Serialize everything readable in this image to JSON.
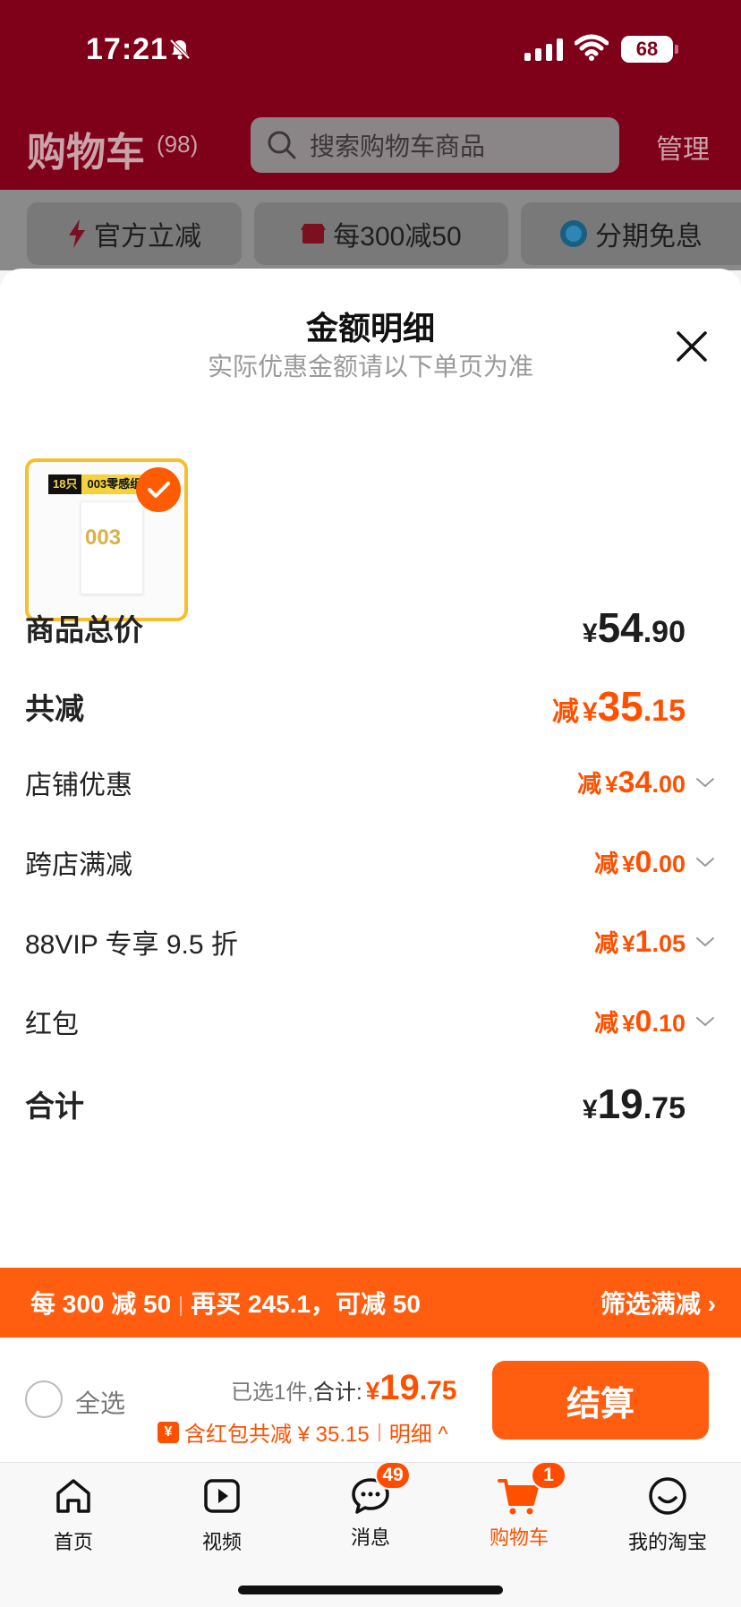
{
  "status": {
    "time": "17:21",
    "battery": "68"
  },
  "header": {
    "title": "购物车",
    "count": "(98)",
    "search_placeholder": "搜索购物车商品",
    "manage": "管理"
  },
  "promos": [
    "官方立减",
    "每300减50",
    "分期免息"
  ],
  "sheet": {
    "title": "金额明细",
    "subtitle": "实际优惠金额请以下单页为准",
    "product": {
      "tag_count": "18只",
      "tag_name": "003零感组",
      "box_text": "003"
    },
    "rows": [
      {
        "label": "商品总价",
        "prefix": "",
        "symbol": "¥",
        "int": "54",
        "dec": ".90"
      },
      {
        "label": "共减",
        "prefix": "减",
        "symbol": "¥",
        "int": "35",
        "dec": ".15"
      },
      {
        "label": "店铺优惠",
        "prefix": "减",
        "symbol": "¥",
        "int": "34",
        "dec": ".00"
      },
      {
        "label": "跨店满减",
        "prefix": "减",
        "symbol": "¥",
        "int": "0",
        "dec": ".00"
      },
      {
        "label": "88VIP 专享 9.5 折",
        "prefix": "减",
        "symbol": "¥",
        "int": "1",
        "dec": ".05"
      },
      {
        "label": "红包",
        "prefix": "减",
        "symbol": "¥",
        "int": "0",
        "dec": ".10"
      },
      {
        "label": "合计",
        "prefix": "",
        "symbol": "¥",
        "int": "19",
        "dec": ".75"
      }
    ]
  },
  "promo_bar": {
    "left_a": "每 300 减 50",
    "left_b": "再买 245.1，可减 50",
    "right": "筛选满减 ›"
  },
  "checkout": {
    "select_all": "全选",
    "selected": "已选1件,",
    "sum_label": "合计:",
    "price_symbol": "¥",
    "price_int": "19",
    "price_dec": ".75",
    "badge": "¥",
    "discount_text": "含红包共减 ¥ 35.15",
    "detail": "明细 ^",
    "settle": "结算"
  },
  "tabs": [
    {
      "label": "首页",
      "badge": ""
    },
    {
      "label": "视频",
      "badge": ""
    },
    {
      "label": "消息",
      "badge": "49"
    },
    {
      "label": "购物车",
      "badge": "1"
    },
    {
      "label": "我的淘宝",
      "badge": ""
    }
  ],
  "colors": {
    "accent": "#ff5000",
    "header": "#7f0019"
  }
}
